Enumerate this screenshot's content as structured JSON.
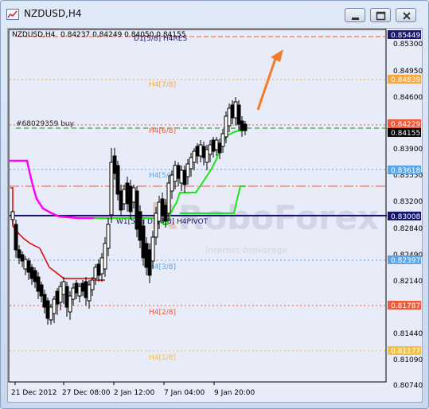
{
  "window": {
    "title": "NZDUSD,H4"
  },
  "header": {
    "symbol_tf": "NZDUSD,H4",
    "ohlc": "0.84237 0.84249 0.84050 0.84155"
  },
  "watermark": {
    "brand": "RoboForex",
    "tagline": "Internet-brokerage"
  },
  "price_axis": {
    "ticks": [
      "0.85300",
      "0.84950",
      "0.84600",
      "0.83900",
      "0.83550",
      "0.83200",
      "0.82840",
      "0.82490",
      "0.82140",
      "0.81440",
      "0.81090",
      "0.80740"
    ],
    "badges": [
      {
        "text": "0.85449",
        "bg": "#1a1a6e",
        "fg": "#ffffff"
      },
      {
        "text": "0.84839",
        "bg": "#f5a742",
        "fg": "#ffffff"
      },
      {
        "text": "0.84229",
        "bg": "#ee5a3a",
        "fg": "#ffffff"
      },
      {
        "text": "0.84155",
        "bg": "#000000",
        "fg": "#ffffff"
      },
      {
        "text": "0.83618",
        "bg": "#5aa6e6",
        "fg": "#ffffff"
      },
      {
        "text": "0.83008",
        "bg": "#14146e",
        "fg": "#ffffff"
      },
      {
        "text": "0.82397",
        "bg": "#5aa6e6",
        "fg": "#ffffff"
      },
      {
        "text": "0.81787",
        "bg": "#ee5a3a",
        "fg": "#ffffff"
      },
      {
        "text": "0.81177",
        "bg": "#f5c046",
        "fg": "#ffffff"
      }
    ]
  },
  "time_axis": {
    "labels": [
      "21 Dec 2012",
      "27 Dec 08:00",
      "2 Jan 12:00",
      "7 Jan 04:00",
      "9 Jan 20:00"
    ]
  },
  "levels": {
    "d1_res": "D1[5/8] H4RES",
    "h4_78": "H4[7/8]",
    "h4_68": "H4[6/8]",
    "h4_58": "H4[5/8]",
    "pivot": "W1[5/8] D1[3/8] H4PIVOT",
    "h4_38": "H4[3/8]",
    "h4_28": "H4[2/8]",
    "h4_18": "H4[1/8]"
  },
  "order": {
    "label": "#68029359 buy"
  },
  "colors": {
    "res": "#1a1a6e",
    "level78": "#f5a742",
    "level68": "#ee5a3a",
    "level58": "#5aa6e6",
    "pivot": "#14146e",
    "level18": "#f5c046",
    "support_line": "#e00000",
    "trend_line": "#19e619",
    "magenta_line": "#ff00ff",
    "arrow": "#f57a2a"
  },
  "icons": {
    "app": "chart-window-icon",
    "minimize": "minimize-icon",
    "maximize": "maximize-icon",
    "close": "close-icon"
  }
}
